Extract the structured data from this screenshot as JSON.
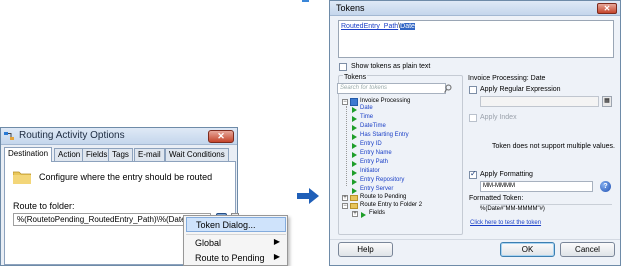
{
  "left_dialog": {
    "title": "Routing Activity Options",
    "close_glyph": "✕",
    "tabs": [
      "Destination",
      "Action",
      "Fields",
      "Tags",
      "E-mail",
      "Wait Conditions"
    ],
    "active_tab": "Destination",
    "description": "Configure where the entry should be routed",
    "route_label": "Route to folder:",
    "route_value": "%(RoutetoPending_RoutedEntry_Path)\\%(Date#\"",
    "token_button_glyph": "▸",
    "browse_button": "...",
    "icons": [
      "routing-activity-icon",
      "folder-icon"
    ]
  },
  "context_menu": {
    "items": [
      {
        "label": "Token Dialog...",
        "highlighted": true,
        "submenu": false
      },
      {
        "label": "Global",
        "highlighted": false,
        "submenu": true
      },
      {
        "label": "Route to Pending",
        "highlighted": false,
        "submenu": true
      }
    ],
    "submenu_glyph": "▶"
  },
  "arrow_color": "#1f5fb8",
  "token_dialog": {
    "title": "Tokens",
    "close_glyph": "✕",
    "expression_link": "RoutedEntry_Path",
    "expression_separator": "\\",
    "expression_selected": "Date",
    "show_plain_text_label": "Show tokens as plain text",
    "tokens_group_label": "Tokens",
    "search_placeholder": "Search for tokens",
    "tree": {
      "root": "Invoice Processing",
      "root_children": [
        "Date",
        "Time",
        "DateTime",
        "Has Starting Entry",
        "Entry ID",
        "Entry Name",
        "Entry Path",
        "Initiator",
        "Entry Repository",
        "Entry Server"
      ],
      "route_to_pending": "Route to Pending",
      "route_entry_folder": "Route Entry to Folder 2",
      "fields": "Fields"
    },
    "right_pane": {
      "section_label": "Invoice Processing: Date",
      "apply_regex_label": "Apply Regular Expression",
      "regex_accel": "R",
      "apply_index_label": "Apply Index",
      "index_accel": "I",
      "multi_value_note": "Token does not support multiple values.",
      "apply_formatting_label": "Apply Formatting",
      "formatting_accel": "F",
      "formatting_value": "MM-MMMM",
      "formatted_token_label": "Formatted Token:",
      "formatted_token_value": "%(Date#\"MM-MMMM\"#)",
      "test_link": "Click here to test the token",
      "help_glyph": "?"
    },
    "buttons": {
      "help": "Help",
      "ok": "OK",
      "cancel": "Cancel"
    },
    "button_accels": {
      "help": "H",
      "ok": "O",
      "cancel": "C"
    }
  }
}
